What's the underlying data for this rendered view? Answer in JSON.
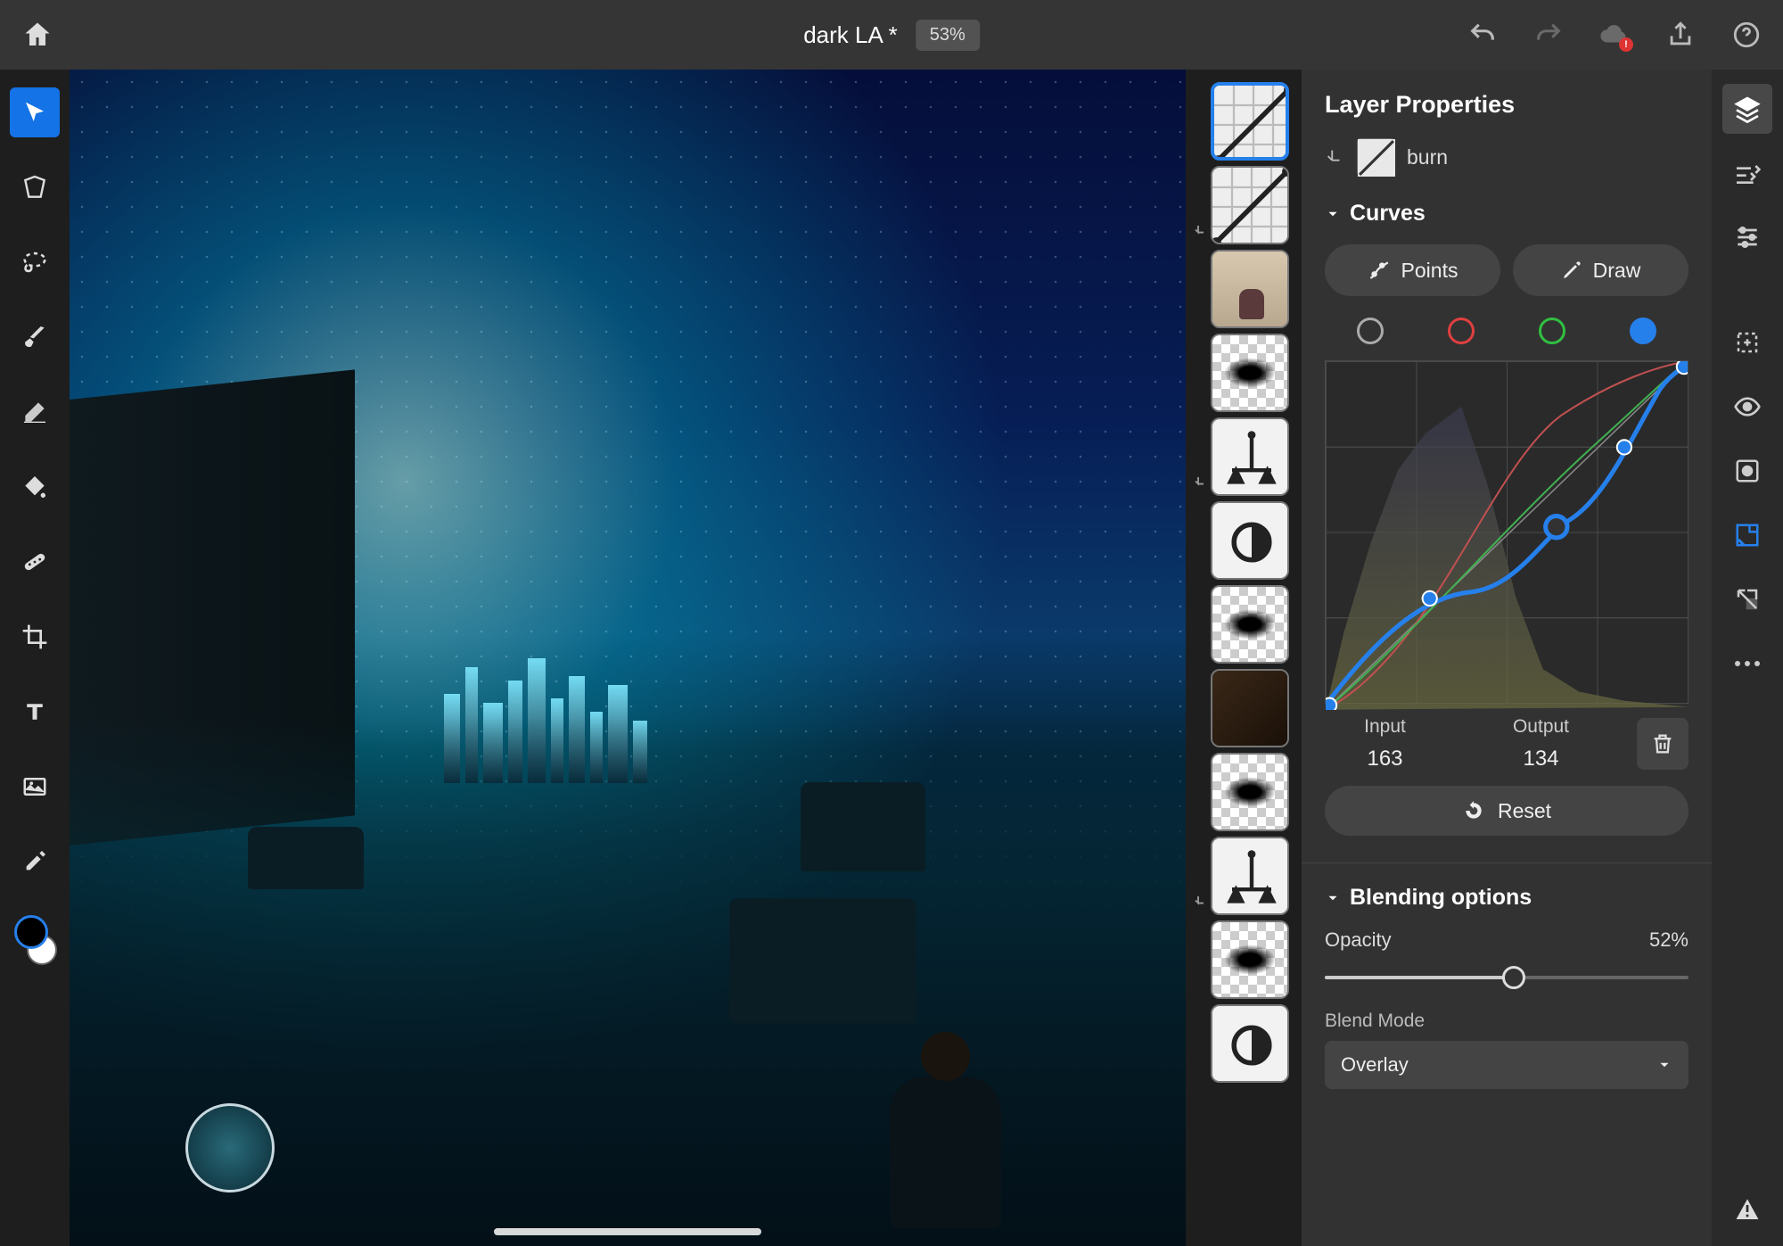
{
  "header": {
    "document_title": "dark LA *",
    "zoom": "53%",
    "cloud_badge": "!"
  },
  "toolbar_left": {
    "items": [
      "move",
      "transform",
      "lasso",
      "brush",
      "eraser",
      "paint-bucket",
      "heal",
      "crop",
      "type",
      "place-image",
      "eyedropper"
    ],
    "active": "move",
    "foreground_color": "#000000",
    "background_color": "#ffffff"
  },
  "layers_column": {
    "items": [
      {
        "kind": "curves",
        "selected": true,
        "clipped": false
      },
      {
        "kind": "curves",
        "selected": false,
        "clipped": true
      },
      {
        "kind": "image-boy",
        "selected": false,
        "clipped": false
      },
      {
        "kind": "mask-smudge",
        "selected": false,
        "clipped": false
      },
      {
        "kind": "color-balance",
        "selected": false,
        "clipped": true
      },
      {
        "kind": "brightness",
        "selected": false,
        "clipped": false
      },
      {
        "kind": "mask-smudge",
        "selected": false,
        "clipped": false
      },
      {
        "kind": "image-night",
        "selected": false,
        "clipped": false
      },
      {
        "kind": "mask-smudge",
        "selected": false,
        "clipped": false
      },
      {
        "kind": "color-balance",
        "selected": false,
        "clipped": true
      },
      {
        "kind": "mask-smudge",
        "selected": false,
        "clipped": false
      },
      {
        "kind": "brightness",
        "selected": false,
        "clipped": false
      }
    ]
  },
  "properties": {
    "panel_title": "Layer Properties",
    "layer_name": "burn",
    "section_curves": "Curves",
    "mode_points": "Points",
    "mode_draw": "Draw",
    "channels": [
      "all",
      "red",
      "green",
      "blue"
    ],
    "active_channel": "blue",
    "input_label": "Input",
    "output_label": "Output",
    "input_value": "163",
    "output_value": "134",
    "reset_label": "Reset",
    "section_blending": "Blending options",
    "opacity_label": "Opacity",
    "opacity_value": "52%",
    "opacity_fraction": 0.52,
    "blend_mode_label": "Blend Mode",
    "blend_mode_value": "Overlay"
  },
  "right_rail": {
    "items": [
      "layers",
      "adjustments",
      "properties"
    ],
    "active": "layers",
    "secondary": [
      "add",
      "visibility",
      "mask",
      "fx",
      "clip",
      "more"
    ]
  }
}
